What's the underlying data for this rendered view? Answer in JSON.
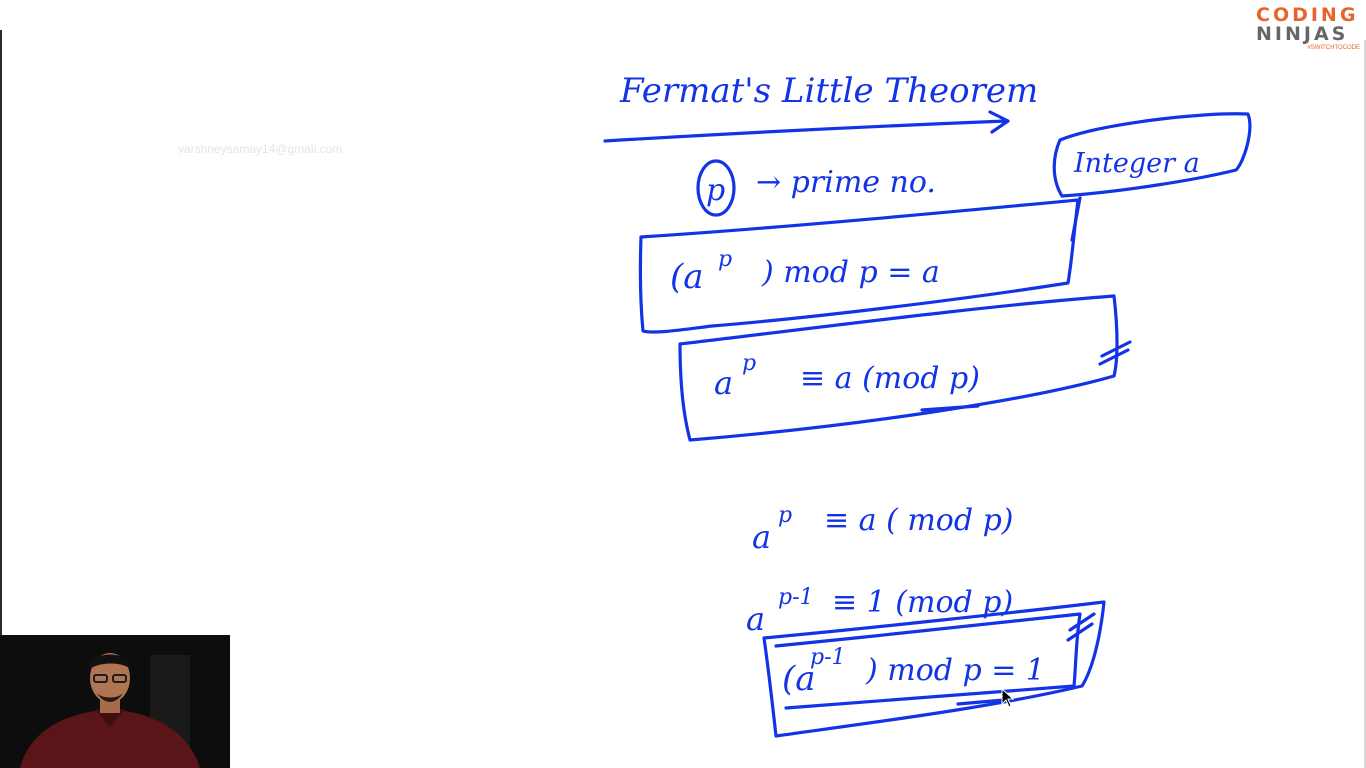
{
  "watermark": {
    "email": "varshneysamay14@gmail.com"
  },
  "brand": {
    "line1": "CODING",
    "line2": "NINJAS",
    "tagline": "#SWITCHTOCODE",
    "colors": {
      "orange": "#e8642c",
      "gray": "#666666"
    }
  },
  "whiteboard": {
    "ink_color": "#1233e6",
    "title": "Fermat's Little Theorem",
    "prime_label": "p",
    "prime_text": "→ prime no.",
    "integer_label": "Integer a",
    "eq1": {
      "base": "(a",
      "exp": "p",
      "rest": ") mod p = a"
    },
    "eq2": {
      "base": "a",
      "exp": "p",
      "rest": "≡ a (mod p)"
    },
    "eq3": {
      "base": "a",
      "exp": "p",
      "rest": "≡ a ( mod p)"
    },
    "eq4": {
      "base": "a",
      "exp": "p-1",
      "rest": "≡ 1 (mod p)"
    },
    "eq5": {
      "base": "(a",
      "exp": "p-1",
      "rest": ") mod p = 1"
    }
  },
  "webcam": {
    "icon": "presenter-video-icon"
  },
  "cursor": {
    "icon": "mouse-pointer-icon"
  }
}
